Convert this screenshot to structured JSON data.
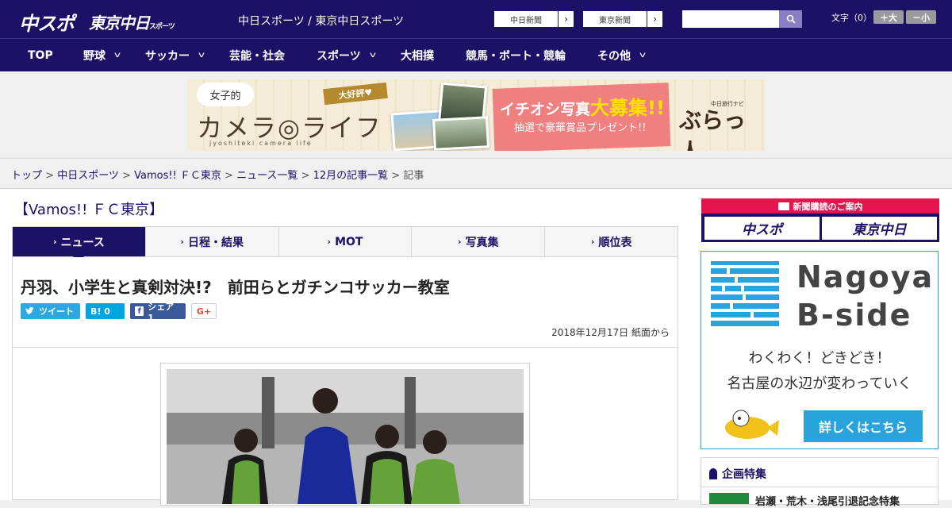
{
  "header": {
    "logo_chuspo": "中スポ",
    "logo_tokyo": "東京中日",
    "logo_tokyo_small": "スポーツ",
    "site_links": "中日スポーツ / 東京中日スポーツ",
    "btn_chunichi": "中日新聞",
    "btn_tokyo": "東京新聞",
    "font_label": "文字（0）",
    "font_plus": "＋大",
    "font_minus": "－小"
  },
  "nav": [
    {
      "label": "TOP",
      "has_menu": false
    },
    {
      "label": "野球",
      "has_menu": true
    },
    {
      "label": "サッカー",
      "has_menu": true
    },
    {
      "label": "芸能・社会",
      "has_menu": false
    },
    {
      "label": "スポーツ",
      "has_menu": true
    },
    {
      "label": "大相撲",
      "has_menu": false
    },
    {
      "label": "競馬・ボート・競輪",
      "has_menu": false
    },
    {
      "label": "その他",
      "has_menu": true
    }
  ],
  "banner": {
    "joshi": "女子的",
    "camera_life": "カメラ◎ライフ",
    "sub": "jyoshiteki camera life",
    "ribbon": "大好評♥",
    "headline_a": "イチオシ写真",
    "headline_b": "大募集!!",
    "prize": "抽選で豪華賞品プレゼント!!",
    "brand_small": "中日旅行ナビ",
    "brand": "ぶらっ人"
  },
  "breadcrumb": {
    "items": [
      "トップ",
      "中日スポーツ",
      "Vamos!! ＦＣ東京",
      "ニュース一覧",
      "12月の記事一覧"
    ],
    "current": "記事",
    "sep": " > "
  },
  "section_title": "【Vamos!! ＦＣ東京】",
  "tabs": [
    {
      "label": "ニュース",
      "active": true
    },
    {
      "label": "日程・結果",
      "active": false
    },
    {
      "label": "MOT",
      "active": false
    },
    {
      "label": "写真集",
      "active": false
    },
    {
      "label": "順位表",
      "active": false
    }
  ],
  "article": {
    "headline": "丹羽、小学生と真剣対決!?　前田らとガチンコサッカー教室",
    "tweet": "ツイート",
    "hatena": "B! 0",
    "facebook": "シェア 1",
    "gplus": "G+",
    "date": "2018年12月17日 紙面から"
  },
  "sidebar": {
    "subscribe_head": "新聞購読のご案内",
    "sub_chuspo": "中スポ",
    "sub_tokyo": "東京中日",
    "bside_line1": "Nagoya",
    "bside_line2": "B-side",
    "bside_text1": "わくわく！どきどき！",
    "bside_text2": "名古屋の水辺が変わっていく",
    "bside_button": "詳しくはこちら",
    "kikaku_title": "企画特集",
    "kikaku_item": "岩瀬・荒木・浅尾引退記念特集"
  },
  "colors": {
    "brand": "#1b1166",
    "accent_red": "#e4154b",
    "accent_blue": "#2aa3dd"
  }
}
